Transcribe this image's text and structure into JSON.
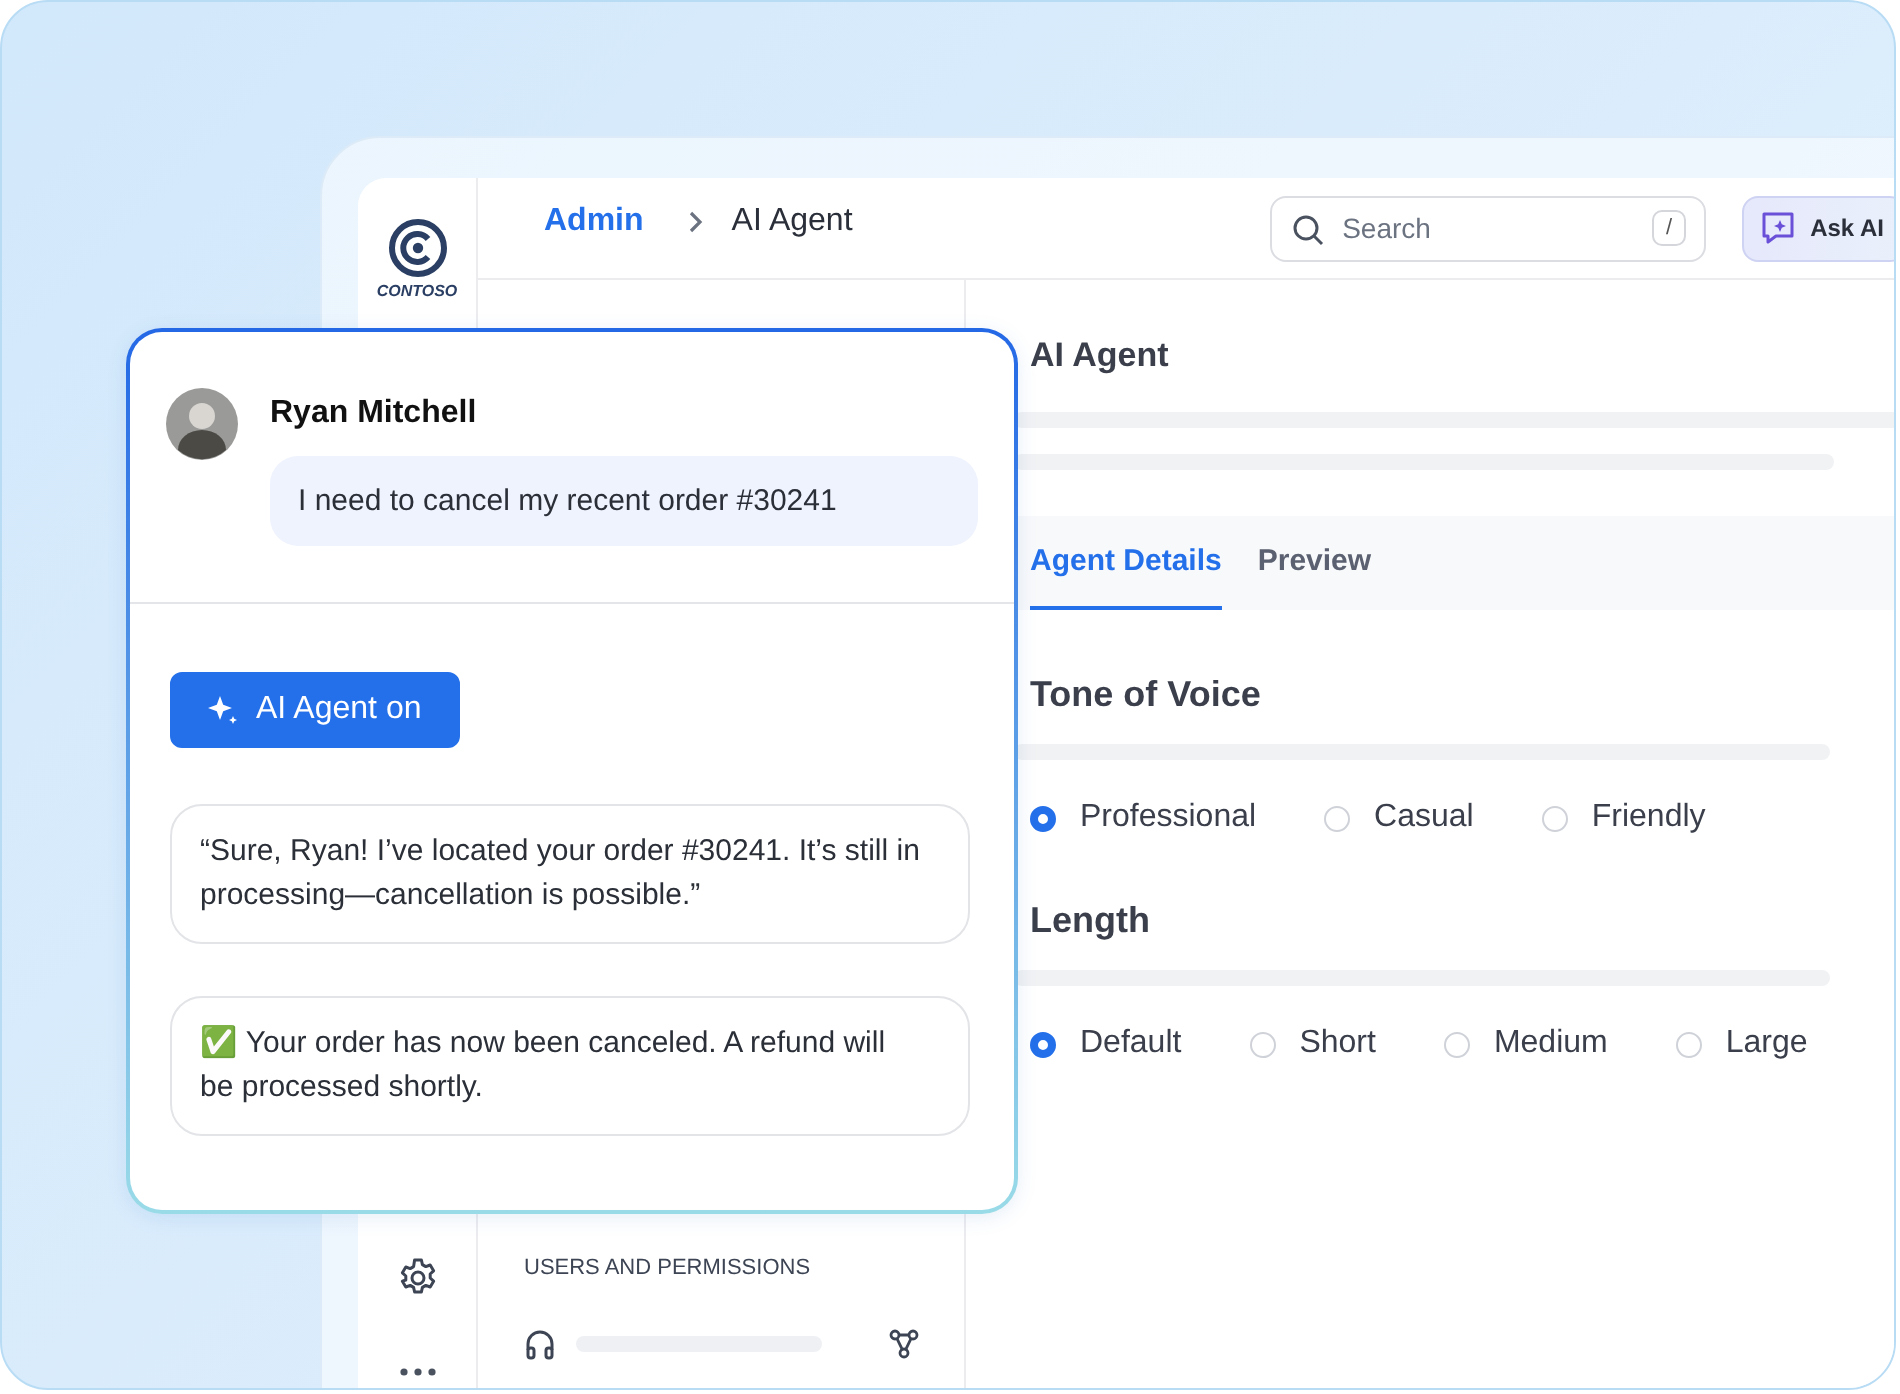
{
  "sidebar": {
    "logo_text": "CONTOSO"
  },
  "header": {
    "breadcrumbs": [
      {
        "label": "Admin",
        "current": false
      },
      {
        "label": "AI Agent",
        "current": true
      }
    ],
    "search": {
      "placeholder": "Search",
      "shortcut": "/"
    },
    "ask_button": "Ask AI"
  },
  "left_panel": {
    "section_title": "USERS AND PERMISSIONS"
  },
  "main": {
    "title": "AI Agent",
    "tabs": [
      {
        "label": "Agent Details",
        "selected": true
      },
      {
        "label": "Preview",
        "selected": false
      }
    ],
    "groups": [
      {
        "title": "Tone of Voice",
        "options": [
          {
            "label": "Professional",
            "selected": true
          },
          {
            "label": "Casual",
            "selected": false
          },
          {
            "label": "Friendly",
            "selected": false
          }
        ]
      },
      {
        "title": "Length",
        "options": [
          {
            "label": "Default",
            "selected": true
          },
          {
            "label": "Short",
            "selected": false
          },
          {
            "label": "Medium",
            "selected": false
          },
          {
            "label": "Large",
            "selected": false
          }
        ]
      }
    ]
  },
  "chat": {
    "customer": {
      "name": "Ryan Mitchell",
      "message": "I need to cancel my recent order #30241"
    },
    "agent_toggle": {
      "label": "AI Agent on",
      "on": true
    },
    "replies": [
      {
        "text": "“Sure, Ryan! I’ve located your order #30241. It’s still in processing—cancellation is possible.”"
      },
      {
        "text": "✅ Your order has now been canceled. A refund will be processed shortly."
      }
    ]
  }
}
